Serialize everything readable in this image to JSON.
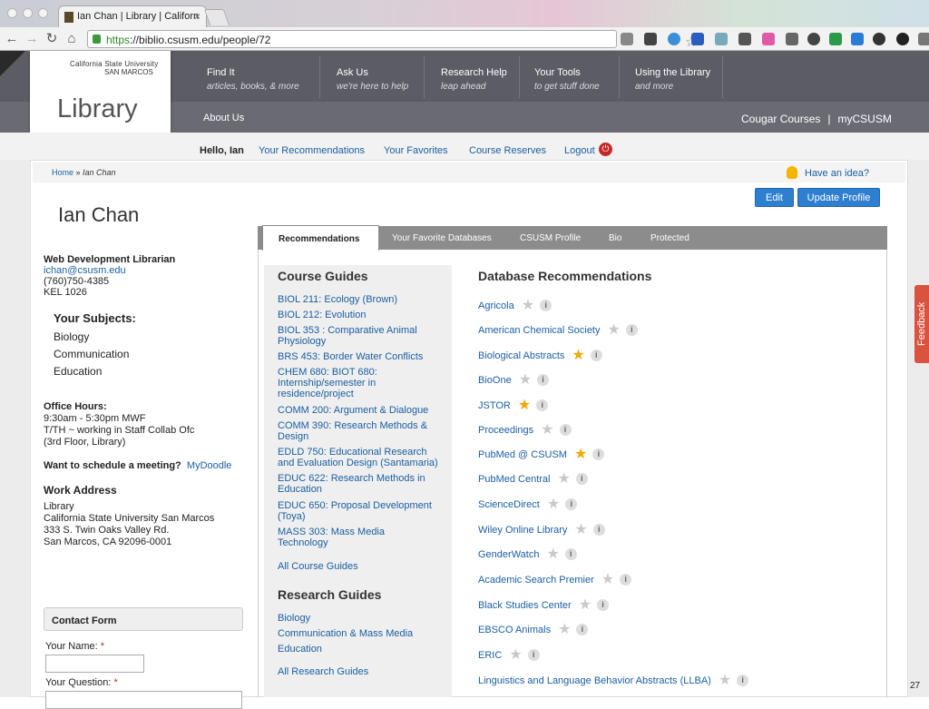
{
  "browser": {
    "tab_title": "Ian Chan | Library | Californ",
    "tab_close": "×",
    "url_scheme": "https",
    "url_rest": "://biblio.csusm.edu/people/72"
  },
  "site": {
    "univ_name": "California State University",
    "univ_campus": "SAN MARCOS",
    "library": "Library",
    "nav": [
      {
        "label": "Find It",
        "sub": "articles, books, & more"
      },
      {
        "label": "Ask Us",
        "sub": "we're here to help"
      },
      {
        "label": "Research Help",
        "sub": "leap ahead"
      },
      {
        "label": "Your Tools",
        "sub": "to get stuff done"
      },
      {
        "label": "Using the Library",
        "sub": "and more"
      }
    ],
    "about": "About Us",
    "cougar": "Cougar Courses",
    "sep": "|",
    "mycsusm": "myCSUSM"
  },
  "user_bar": {
    "hello": "Hello, Ian",
    "links": [
      "Your Recommendations",
      "Your Favorites",
      "Course Reserves",
      "Logout"
    ]
  },
  "breadcrumb": {
    "home": "Home",
    "sep": " » ",
    "current": "Ian Chan"
  },
  "idea": "Have an idea?",
  "buttons": {
    "edit": "Edit",
    "update": "Update Profile"
  },
  "profile": {
    "name": "Ian Chan",
    "title": "Web Development Librarian",
    "email": "ichan@csusm.edu",
    "phone": "(760)750-4385",
    "office": "KEL 1026",
    "subjects_title": "Your Subjects:",
    "subjects": [
      "Biology",
      "Communication",
      "Education"
    ],
    "hours_title": "Office Hours:",
    "hours": [
      "9:30am - 5:30pm MWF",
      "T/TH ~ working in Staff Collab Ofc",
      "(3rd Floor, Library)"
    ],
    "meet_q": "Want to schedule a meeting?",
    "meet_link": "MyDoodle",
    "work_title": "Work Address",
    "work": [
      "Library",
      "California State University San Marcos",
      "333 S. Twin Oaks Valley Rd.",
      "San Marcos, CA 92096-0001"
    ]
  },
  "contact": {
    "title": "Contact Form",
    "name_label": "Your Name:",
    "question_label": "Your Question:",
    "required": "*"
  },
  "tabs": [
    "Recommendations",
    "Your Favorite Databases",
    "CSUSM Profile",
    "Bio",
    "Protected"
  ],
  "course_guides": {
    "title": "Course Guides",
    "items": [
      "BIOL 211: Ecology (Brown)",
      "BIOL 212: Evolution",
      "BIOL 353 : Comparative Animal Physiology",
      "BRS 453: Border Water Conflicts",
      "CHEM 680: BIOT 680: Internship/semester in residence/project",
      "COMM 200: Argument & Dialogue",
      "COMM 390: Research Methods & Design",
      "EDLD 750: Educational Research and Evaluation Design (Santamaria)",
      "EDUC 622: Research Methods in Education",
      "EDUC 650: Proposal Development (Toya)",
      "MASS 303: Mass Media Technology"
    ],
    "all": "All Course Guides"
  },
  "research_guides": {
    "title": "Research Guides",
    "items": [
      "Biology",
      "Communication & Mass Media",
      "Education"
    ],
    "all": "All Research Guides"
  },
  "databases": {
    "title": "Database Recommendations",
    "star_glyph": "★",
    "info_glyph": "i",
    "items": [
      {
        "name": "Agricola",
        "fav": false
      },
      {
        "name": "American Chemical Society",
        "fav": false
      },
      {
        "name": "Biological Abstracts",
        "fav": true
      },
      {
        "name": "BioOne",
        "fav": false
      },
      {
        "name": "JSTOR",
        "fav": true
      },
      {
        "name": "Proceedings",
        "fav": false
      },
      {
        "name": "PubMed @ CSUSM",
        "fav": true
      },
      {
        "name": "PubMed Central",
        "fav": false
      },
      {
        "name": "ScienceDirect",
        "fav": false
      },
      {
        "name": "Wiley Online Library",
        "fav": false
      },
      {
        "name": "GenderWatch",
        "fav": false
      },
      {
        "name": "Academic Search Premier",
        "fav": false
      },
      {
        "name": "Black Studies Center",
        "fav": false
      },
      {
        "name": "EBSCO Animals",
        "fav": false
      },
      {
        "name": "ERIC",
        "fav": false
      },
      {
        "name": "Linguistics and Language Behavior Abstracts (LLBA)",
        "fav": false
      }
    ]
  },
  "feedback": "Feedback",
  "page_number": "27",
  "colors": {
    "accent": "#1b5fa2",
    "button": "#2f7fd1",
    "star_on": "#f2a900",
    "logout": "#c62828",
    "feedback": "#d9533e"
  }
}
